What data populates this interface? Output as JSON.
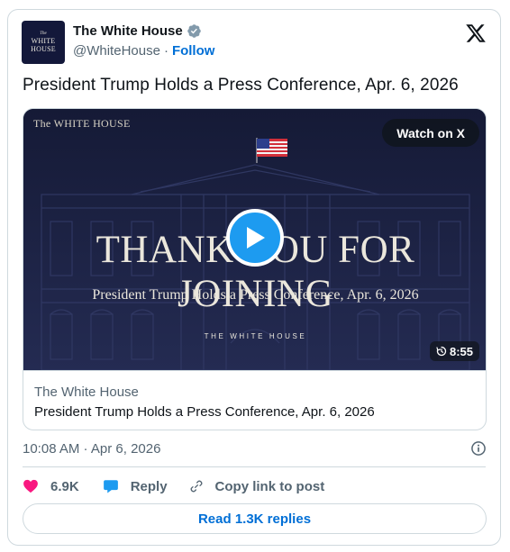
{
  "account": {
    "display_name": "The White House",
    "handle": "@WhiteHouse",
    "separator": "·",
    "follow_label": "Follow",
    "avatar_line1": "The",
    "avatar_line2": "WHITE",
    "avatar_line3": "HOUSE"
  },
  "tweet": {
    "text": "President Trump Holds a Press Conference, Apr. 6, 2026"
  },
  "video": {
    "brand_small": "The WHITE HOUSE",
    "watch_label": "Watch on X",
    "headline": "THANK YOU FOR JOINING",
    "subtitle": "President Trump Holds a Press Conference, Apr. 6, 2026",
    "brand_caps": "THE WHITE HOUSE",
    "duration": "8:55"
  },
  "link_card": {
    "domain": "The White House",
    "title": "President Trump Holds a Press Conference, Apr. 6, 2026"
  },
  "meta": {
    "timestamp": "10:08 AM · Apr 6, 2026"
  },
  "actions": {
    "likes": "6.9K",
    "reply_label": "Reply",
    "copy_label": "Copy link to post"
  },
  "read_replies_label": "Read 1.3K replies",
  "colors": {
    "accent": "#1d9bf0",
    "link": "#006fd6",
    "heart": "#f91880",
    "video_bg": "#1a2040"
  }
}
